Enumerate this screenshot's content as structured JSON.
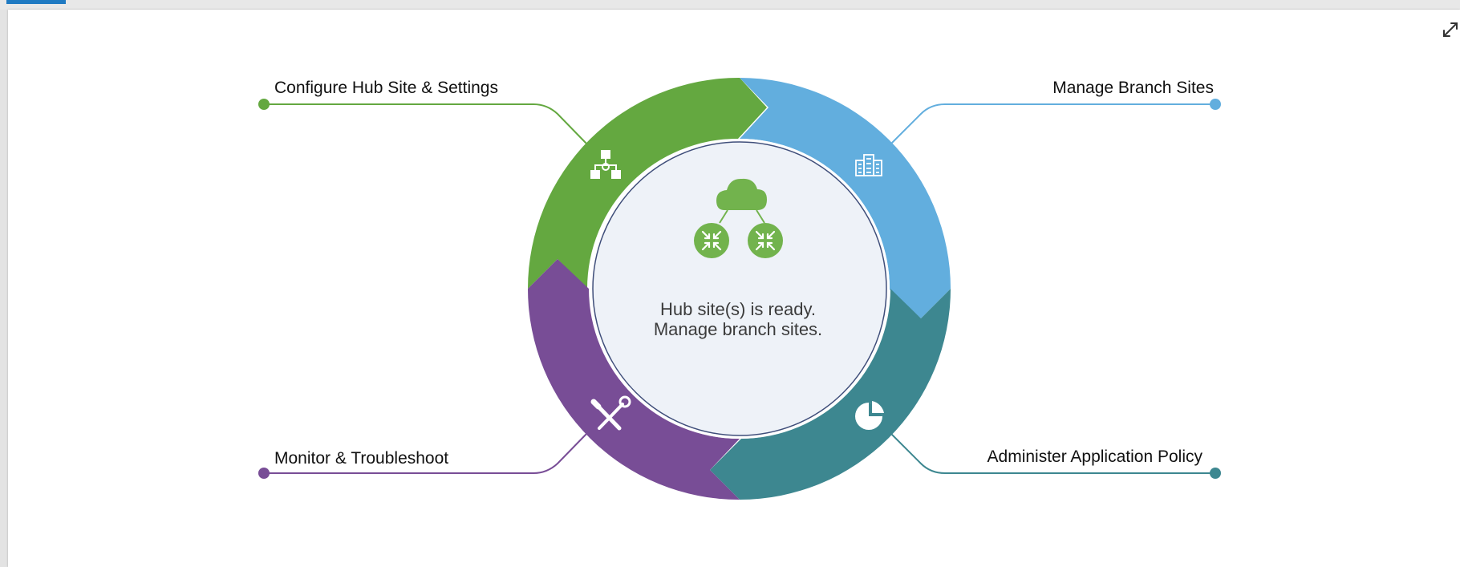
{
  "window": {
    "active_tab_color": "#1f7ac2"
  },
  "center": {
    "status_line1": "Hub site(s) is ready.",
    "status_line2": "Manage branch sites.",
    "icon": "cloud-with-two-routers-icon"
  },
  "steps": [
    {
      "id": "configure-hub",
      "label": "Configure Hub Site & Settings",
      "color": "#64a840",
      "icon": "network-topology-icon"
    },
    {
      "id": "manage-branch",
      "label": "Manage Branch Sites",
      "color": "#62aede",
      "icon": "buildings-icon"
    },
    {
      "id": "administer-policy",
      "label": "Administer Application Policy",
      "color": "#3d8790",
      "icon": "pie-chart-icon"
    },
    {
      "id": "monitor",
      "label": "Monitor & Troubleshoot",
      "color": "#784d96",
      "icon": "tools-icon"
    }
  ],
  "toolbar": {
    "expand_icon": "expand-icon"
  }
}
